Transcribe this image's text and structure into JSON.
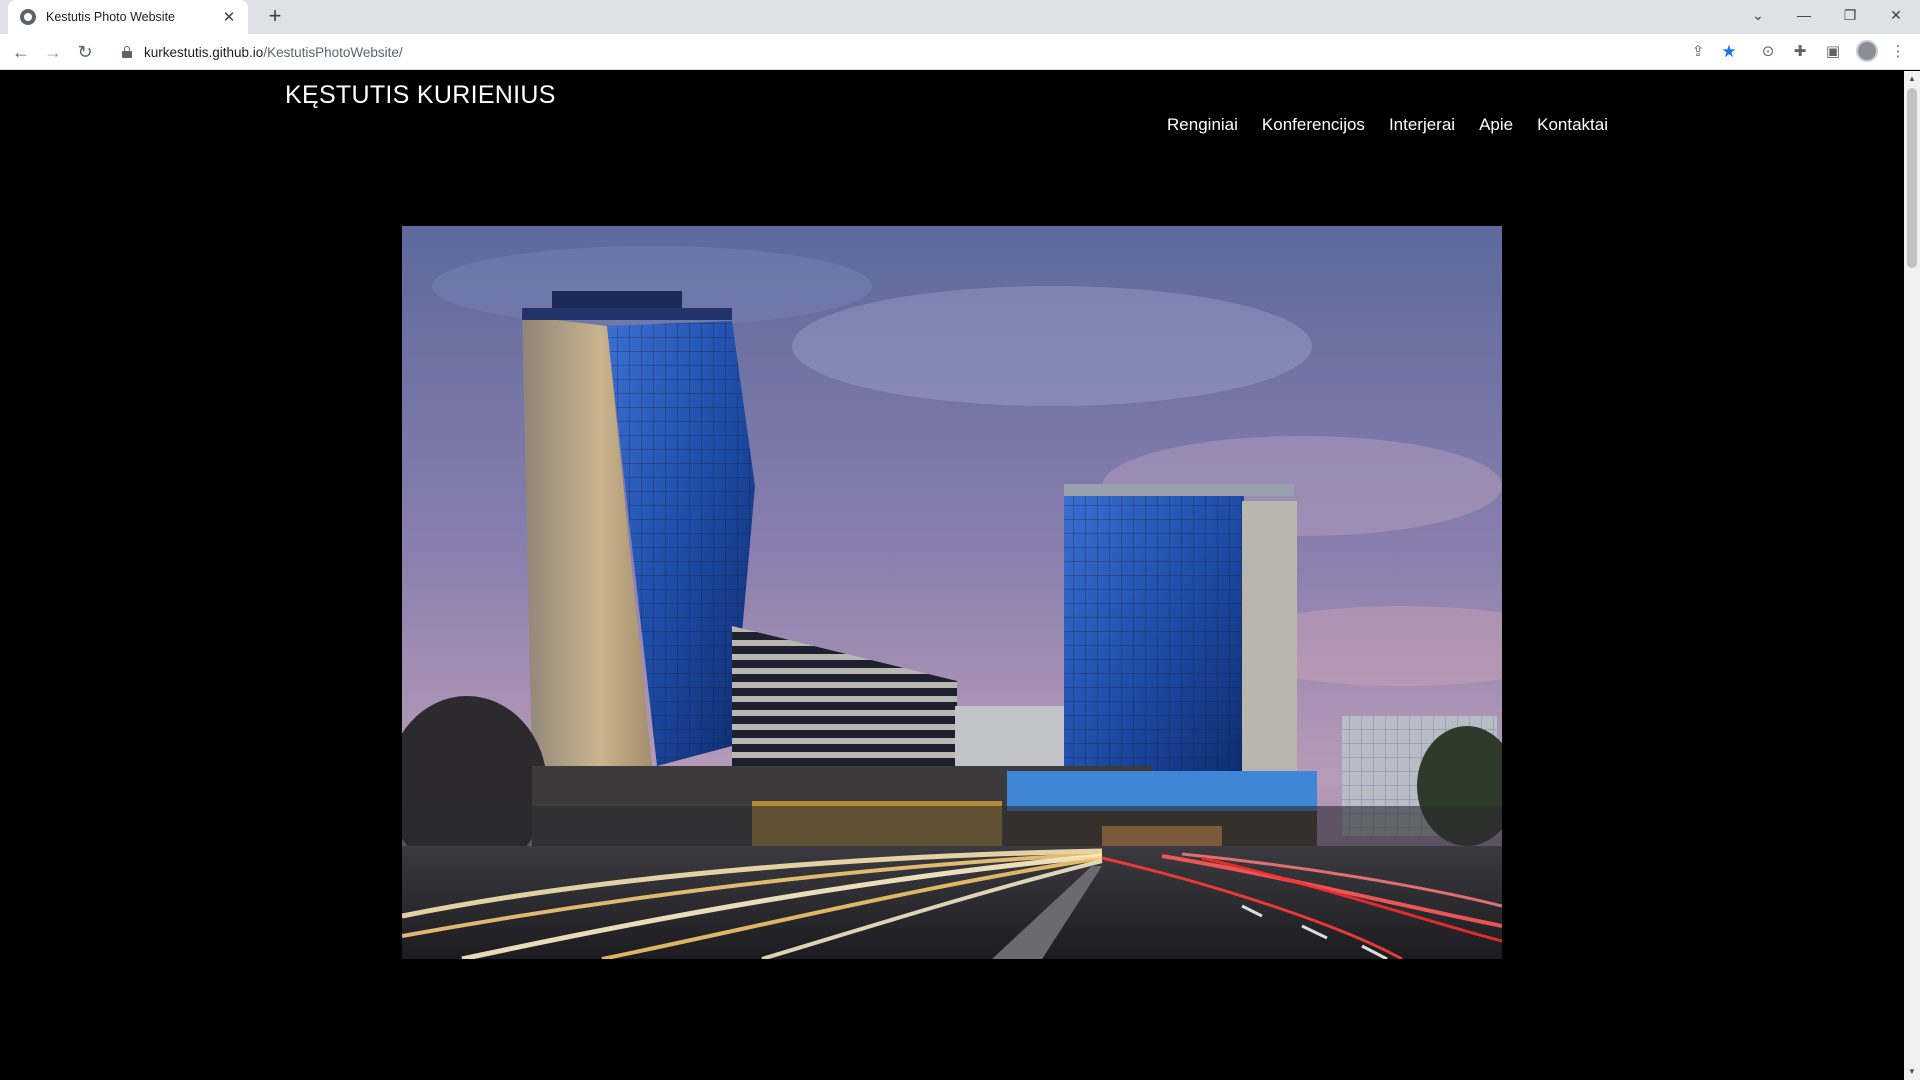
{
  "browser": {
    "tab_title": "Kestutis Photo Website",
    "url_host": "kurkestutis.github.io",
    "url_path": "/KestutisPhotoWebsite/",
    "icons": {
      "tab_close": "close-icon",
      "new_tab": "plus-icon",
      "back": "back-arrow-icon",
      "forward": "forward-arrow-icon",
      "reload": "reload-icon",
      "share": "share-icon",
      "bookmark": "star-icon",
      "screenshot": "screen-capture-icon",
      "extensions": "puzzle-icon",
      "side_panel": "side-panel-icon",
      "profile": "avatar",
      "menu": "kebab-menu-icon"
    }
  },
  "site": {
    "title": "KĘSTUTIS KURIENIUS",
    "nav": [
      "Renginiai",
      "Konferencijos",
      "Interjerai",
      "Apie",
      "Kontaktai"
    ]
  },
  "colors": {
    "page_background": "#000000",
    "text": "#ffffff",
    "bookmark_star": "#1a73e8"
  }
}
